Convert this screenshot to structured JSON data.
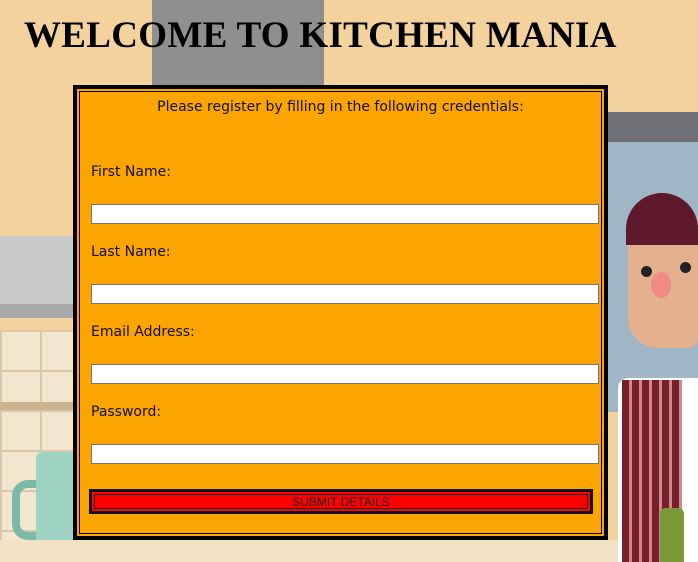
{
  "page": {
    "title": "WELCOME TO KITCHEN MANIA"
  },
  "form": {
    "intro": "Please register by filling in the following credentials:",
    "fields": [
      {
        "label": "First Name:",
        "value": ""
      },
      {
        "label": "Last Name:",
        "value": ""
      },
      {
        "label": "Email Address:",
        "value": ""
      },
      {
        "label": "Password:",
        "value": ""
      }
    ],
    "submit_label": "SUBMIT DETAILS"
  },
  "colors": {
    "panel_background": "#fca400",
    "submit_background": "#ff0000",
    "page_background": "#f3d19c"
  }
}
